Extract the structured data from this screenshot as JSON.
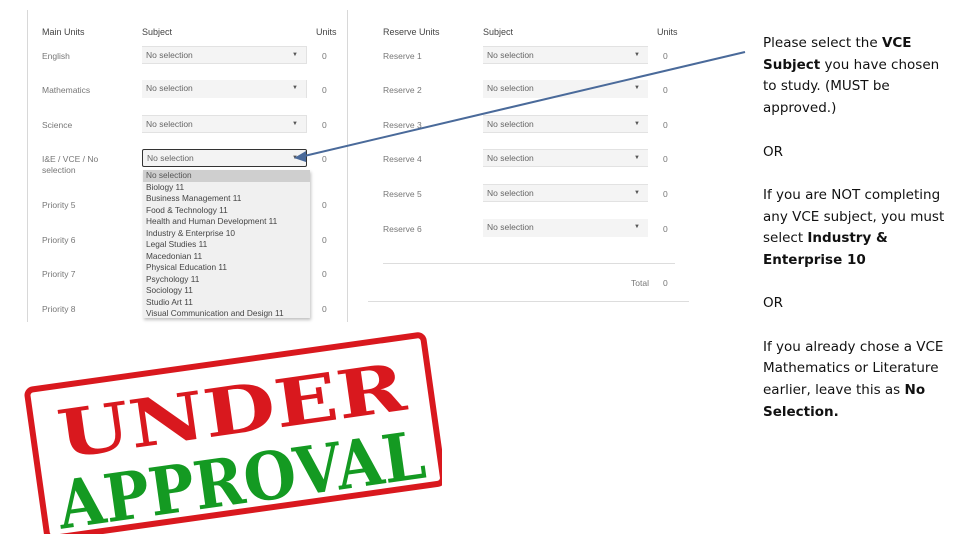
{
  "main": {
    "header": {
      "section": "Main Units",
      "subject": "Subject",
      "units": "Units"
    },
    "rows": [
      {
        "label": "English",
        "value": "No selection",
        "units": "0"
      },
      {
        "label": "Mathematics",
        "value": "No selection",
        "units": "0"
      },
      {
        "label": "Science",
        "value": "No selection",
        "units": "0"
      },
      {
        "label": "I&E / VCE / No selection",
        "value": "No selection",
        "units": "0"
      },
      {
        "label": "Priority 5",
        "units": "0"
      },
      {
        "label": "Priority 6",
        "units": "0"
      },
      {
        "label": "Priority 7",
        "units": "0"
      },
      {
        "label": "Priority 8",
        "units": "0"
      }
    ],
    "dropdown_options": [
      "No selection",
      "Biology 11",
      "Business Management 11",
      "Food & Technology 11",
      "Health and Human Development 11",
      "Industry & Enterprise 10",
      "Legal Studies 11",
      "Macedonian 11",
      "Physical Education 11",
      "Psychology 11",
      "Sociology 11",
      "Studio Art 11",
      "Visual Communication and Design 11"
    ],
    "dropdown_highlighted": "No selection"
  },
  "reserve": {
    "header": {
      "section": "Reserve Units",
      "subject": "Subject",
      "units": "Units"
    },
    "rows": [
      {
        "label": "Reserve 1",
        "value": "No selection",
        "units": "0"
      },
      {
        "label": "Reserve 2",
        "value": "No selection",
        "units": "0"
      },
      {
        "label": "Reserve 3",
        "value": "No selection",
        "units": "0"
      },
      {
        "label": "Reserve 4",
        "value": "No selection",
        "units": "0"
      },
      {
        "label": "Reserve 5",
        "value": "No selection",
        "units": "0"
      },
      {
        "label": "Reserve 6",
        "value": "No selection",
        "units": "0"
      }
    ],
    "total_label": "Total",
    "total_value": "0"
  },
  "instructions": {
    "p1_a": "Please select the ",
    "p1_b": "VCE Subject",
    "p1_c": " you have chosen to study. (MUST be approved.)",
    "or1": "OR",
    "p2_a": "If you are NOT completing any VCE subject, you must select ",
    "p2_b": "Industry & Enterprise 10",
    "or2": "OR",
    "p3_a": "If you already chose a VCE Mathematics or Literature earlier, leave this as ",
    "p3_b": "No Selection."
  },
  "stamp": {
    "line1": "UNDER",
    "line2": "APPROVAL",
    "border_color": "#d9181e",
    "line1_color": "#d9181e",
    "line2_color": "#149a22"
  },
  "arrow_color": "#4a6a9a",
  "caret_glyph": "▼"
}
